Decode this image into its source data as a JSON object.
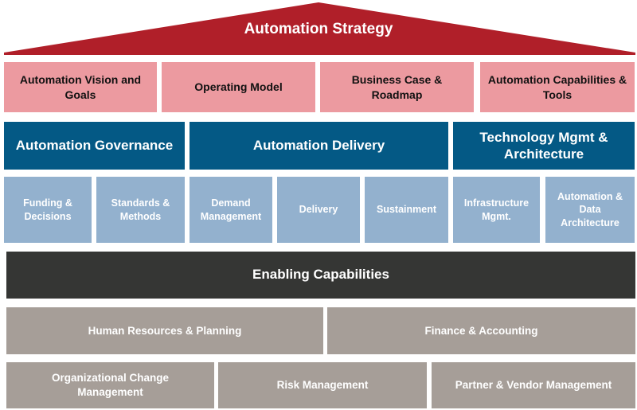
{
  "strategy": {
    "title": "Automation Strategy",
    "items": [
      "Automation Vision and Goals",
      "Operating Model",
      "Business Case & Roadmap",
      "Automation Capabilities & Tools"
    ]
  },
  "pillars": [
    {
      "title": "Automation Governance",
      "items": [
        "Funding & Decisions",
        "Standards & Methods"
      ]
    },
    {
      "title": "Automation Delivery",
      "items": [
        "Demand Management",
        "Delivery",
        "Sustainment"
      ]
    },
    {
      "title": "Technology Mgmt & Architecture",
      "items": [
        "Infrastructure Mgmt.",
        "Automation & Data Architecture"
      ]
    }
  ],
  "enabling": {
    "title": "Enabling Capabilities",
    "row1": [
      "Human Resources & Planning",
      "Finance & Accounting"
    ],
    "row2": [
      "Organizational Change Management",
      "Risk Management",
      "Partner & Vendor Management"
    ]
  },
  "colors": {
    "roof": "#b01f29",
    "strategy_items": "#ec9aa0",
    "pillar_headers": "#045985",
    "pillar_items": "#93b1ce",
    "enabling_header": "#353634",
    "enabling_items": "#a69e98"
  }
}
